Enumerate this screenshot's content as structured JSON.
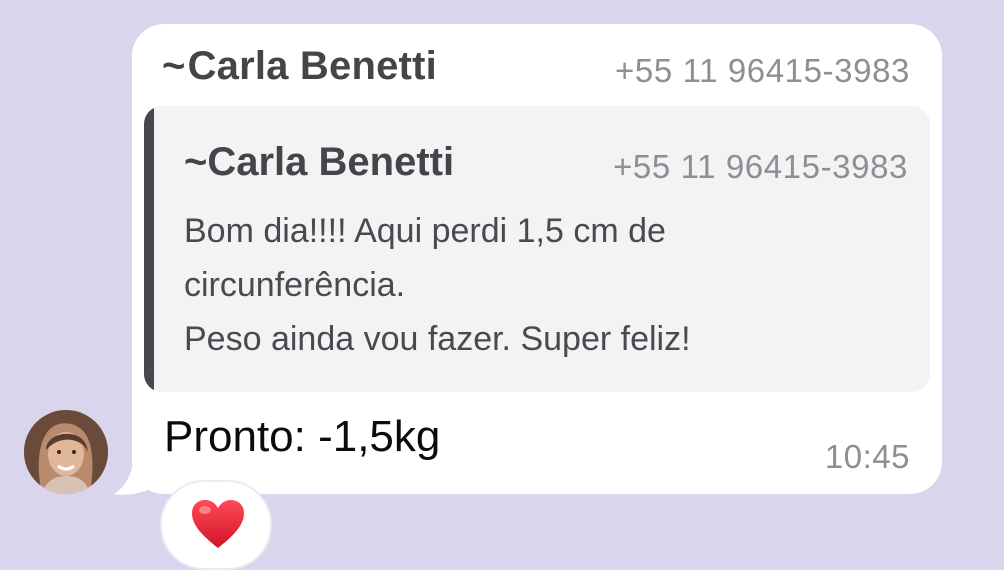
{
  "message": {
    "sender": {
      "tilde": "~",
      "name": "Carla Benetti",
      "phone": "+55 11 96415-3983"
    },
    "quoted": {
      "tilde": "~",
      "name": "Carla Benetti",
      "phone": "+55 11 96415-3983",
      "lines": [
        "Bom dia!!!! Aqui perdi 1,5 cm de",
        "circunferência.",
        "Peso ainda vou fazer. Super feliz!"
      ]
    },
    "text": "Pronto: -1,5kg",
    "time": "10:45",
    "reaction": "heart-icon"
  },
  "colors": {
    "background": "#d8d5ec",
    "bubble": "#ffffff",
    "quote_bg": "#f3f2f4",
    "quote_bar": "#48484c",
    "heart": "#e0202e"
  }
}
